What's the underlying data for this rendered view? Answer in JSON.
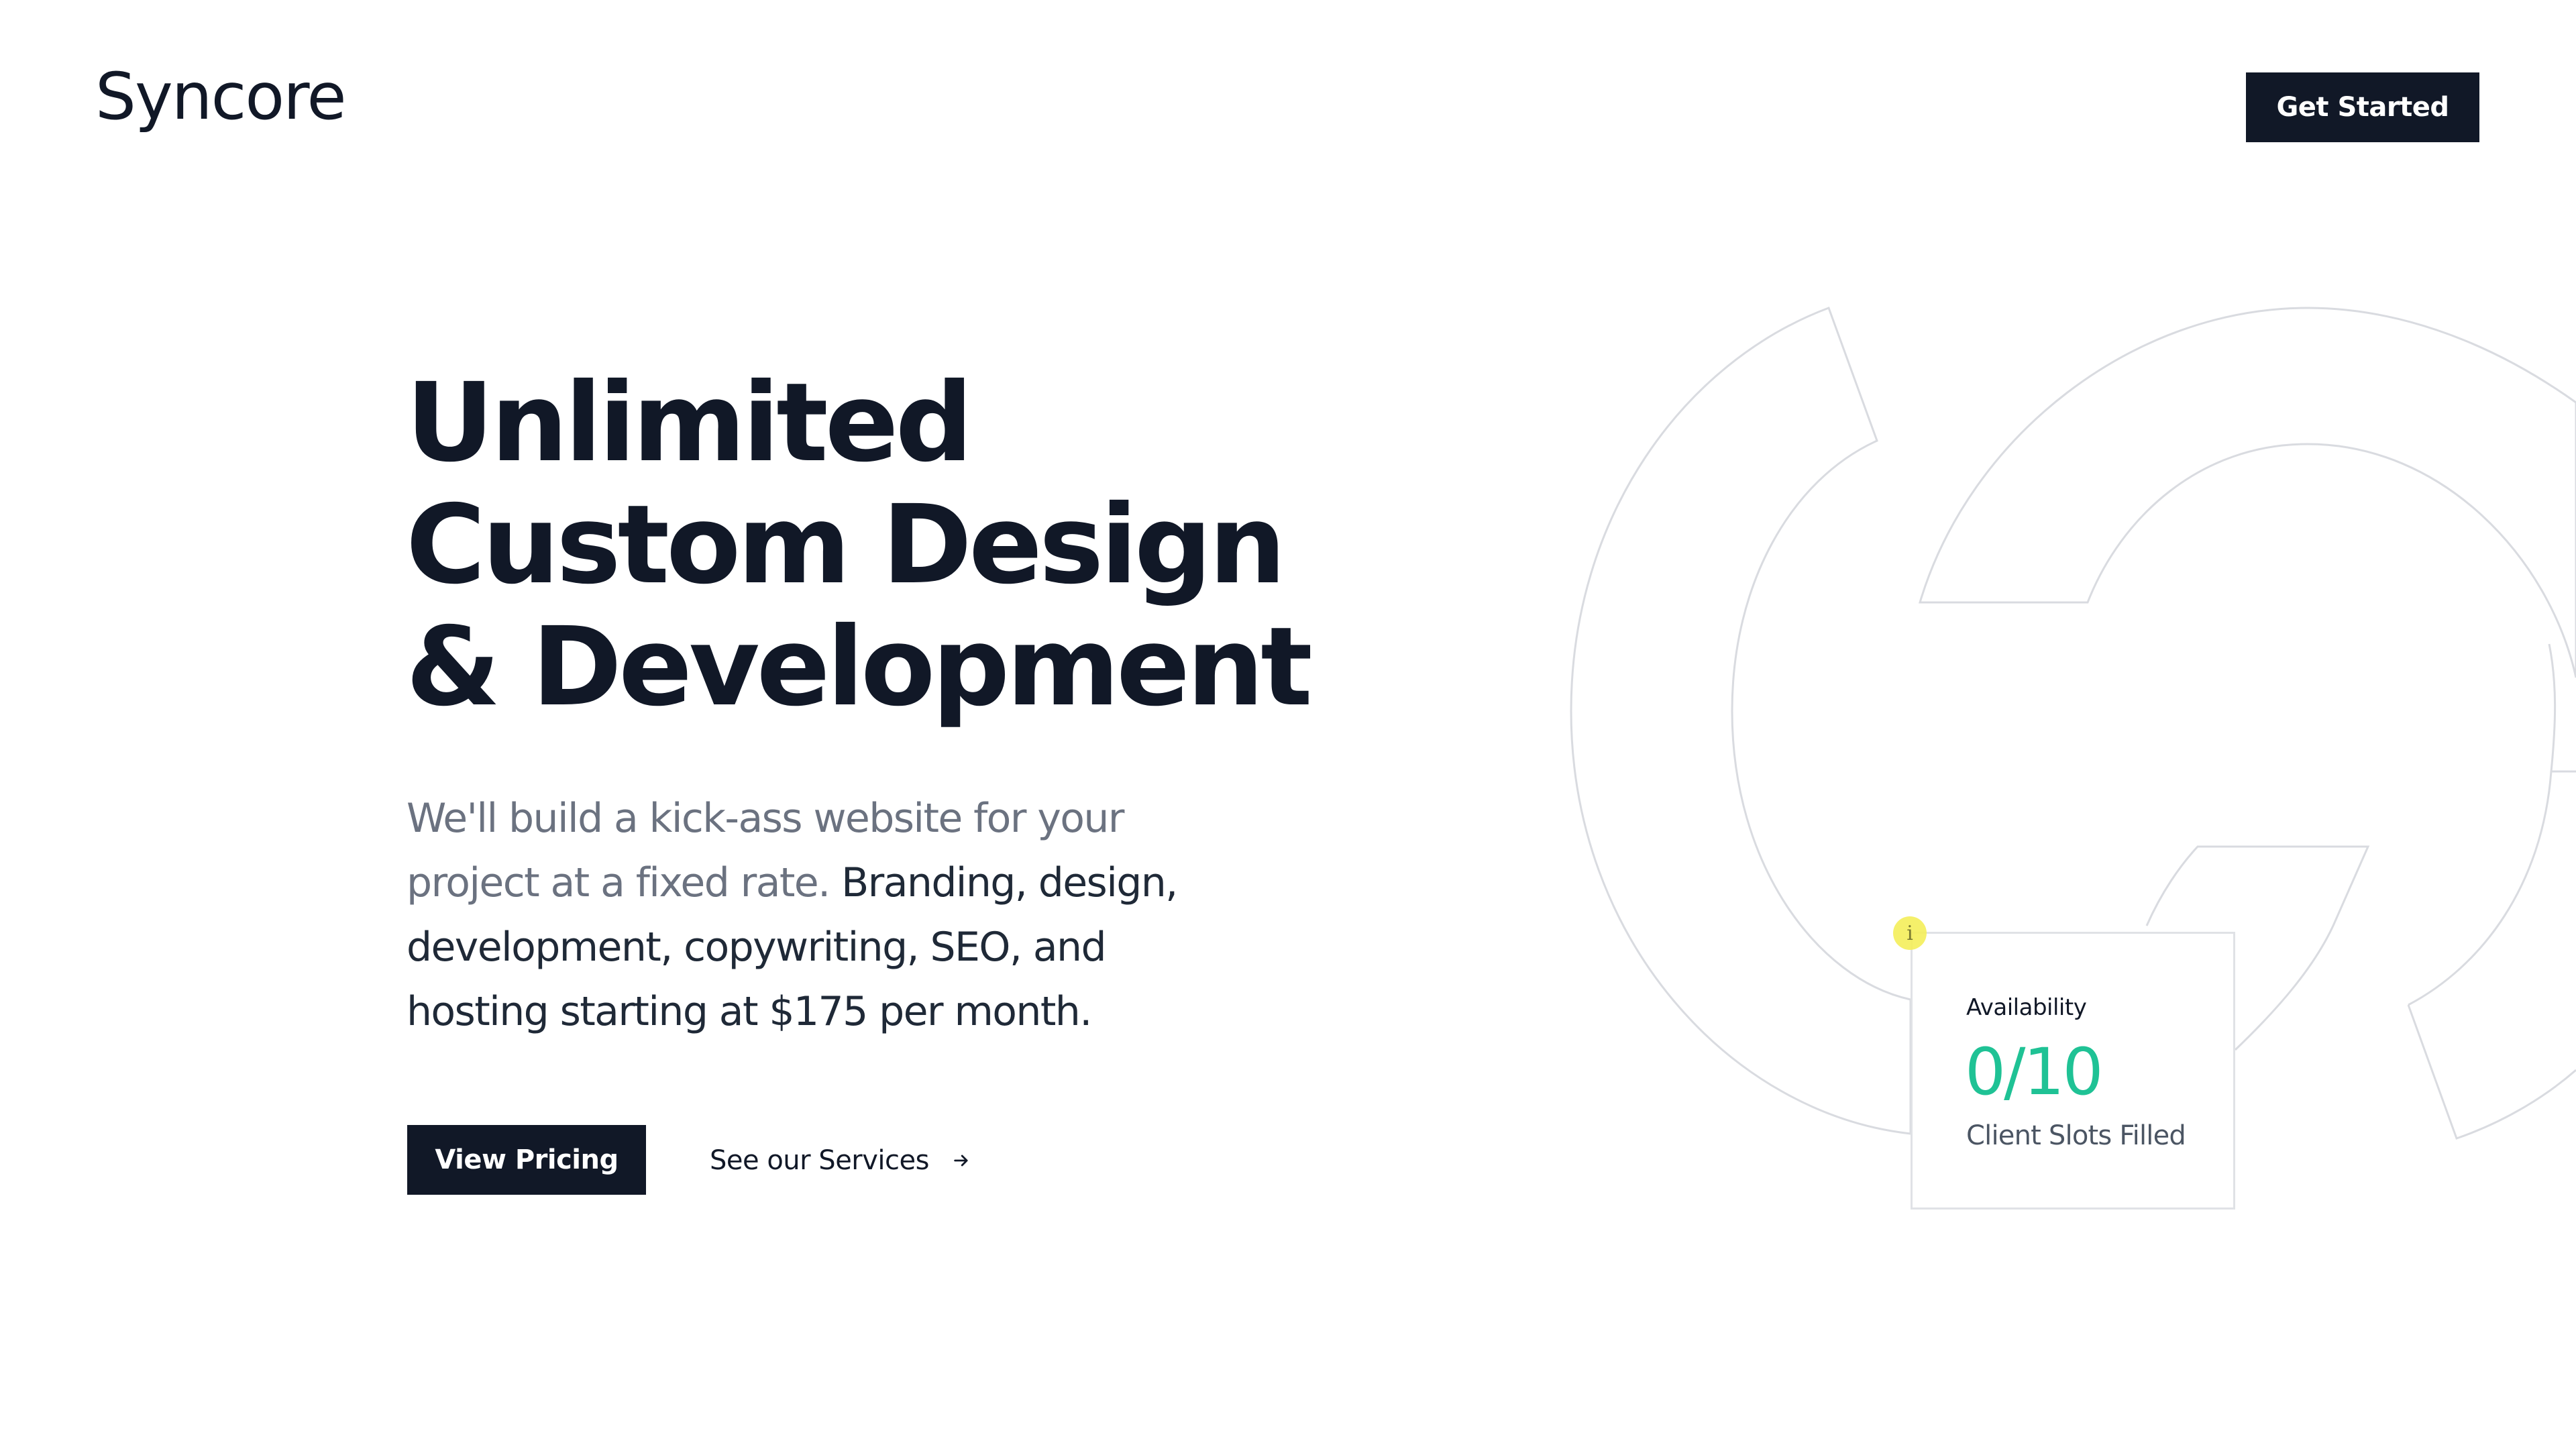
{
  "header": {
    "logo_text": "Syncore",
    "cta_label": "Get Started"
  },
  "hero": {
    "title_lines": [
      "Unlimited",
      "Custom Design",
      "& Development"
    ],
    "description_muted": "We'll build a kick-ass website for your project at a fixed rate.",
    "description_main": "Branding, design, development, copywriting, SEO, and hosting starting at $175 per month.",
    "primary_button": "View Pricing",
    "secondary_link": "See our Services"
  },
  "availability_card": {
    "label": "Availability",
    "value": "0/10",
    "caption": "Client Slots Filled",
    "info_icon_glyph": "i"
  },
  "icons": {
    "arrow": "arrow-right-icon",
    "info": "info-icon",
    "background": "brand-mark-outline"
  },
  "colors": {
    "primary": "#111827",
    "accent_green": "#1fc295",
    "muted_text": "#6b7280",
    "info_dot": "#f5ef5a"
  }
}
